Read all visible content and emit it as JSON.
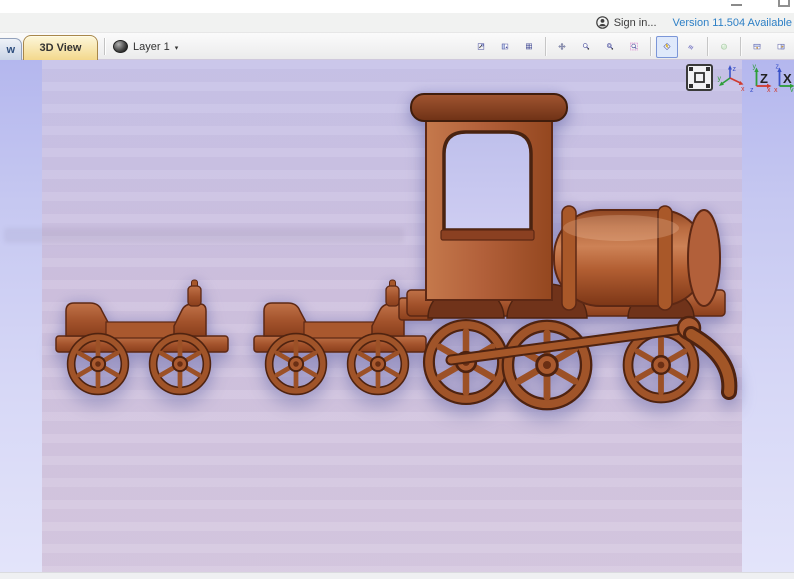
{
  "menubar": {
    "sign_in_label": "Sign in...",
    "version_link": "Version 11.504 Available"
  },
  "tab_bar": {
    "partial_tab_visible_text": "w",
    "active_tab_label": "3D View",
    "layer_selector": {
      "label": "Layer 1",
      "caret": "▾"
    }
  },
  "toolbar": {
    "icons": [
      "zoom-to-drawing-icon",
      "window-layout-icon",
      "snap-grid-icon",
      "pan-icon",
      "zoom-interactive-icon",
      "zoom-box-icon",
      "zoom-selected-icon",
      "color-shaded-view-icon",
      "toggle-toolpath-drawing-icon",
      "save-shaded-image-icon",
      "split-view-horizontal-icon",
      "split-view-vertical-icon"
    ],
    "active_icon": "color-shaded-view-icon"
  },
  "viewport": {
    "scene_description": "Wooden toy train relief - locomotive with two wagons, 3D shaded view",
    "axis_controls": {
      "fit_button_icon": "scale-to-fit-icon",
      "iso": {
        "x": "x",
        "y": "y",
        "z": "z"
      },
      "z_view": {
        "letter": "Z",
        "up": "y",
        "right": "x",
        "origin": "z"
      },
      "x_view": {
        "letter": "X",
        "up": "z",
        "right": "y",
        "origin": "x"
      }
    }
  },
  "colors": {
    "version_link": "#2e80c6",
    "active_tab_bg": "#f3d88c",
    "wood_mid": "#b2603a",
    "viewport_top": "#b4b7ee",
    "material_mid": "#cfc2df"
  }
}
